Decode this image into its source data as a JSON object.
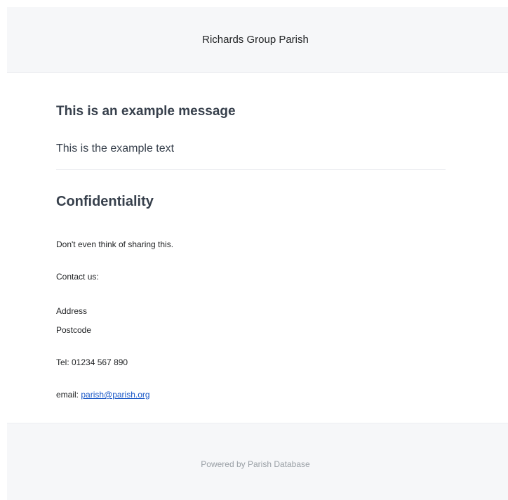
{
  "header": {
    "title": "Richards Group Parish"
  },
  "message": {
    "title": "This is an example message",
    "body": "This is the example text"
  },
  "confidentiality": {
    "title": "Confidentiality",
    "notice": "Don't even think of sharing this.",
    "contact_label": "Contact us:",
    "address_line": "Address",
    "postcode_line": "Postcode",
    "tel": "Tel: 01234 567 890",
    "email_label": "email: ",
    "email_address": "parish@parish.org"
  },
  "footer": {
    "text": "Powered by Parish Database"
  },
  "colors": {
    "header_background": "#f6f7f9",
    "heading_text": "#37404c",
    "link": "#1a58c7",
    "footer_text": "#9aa0a6"
  }
}
